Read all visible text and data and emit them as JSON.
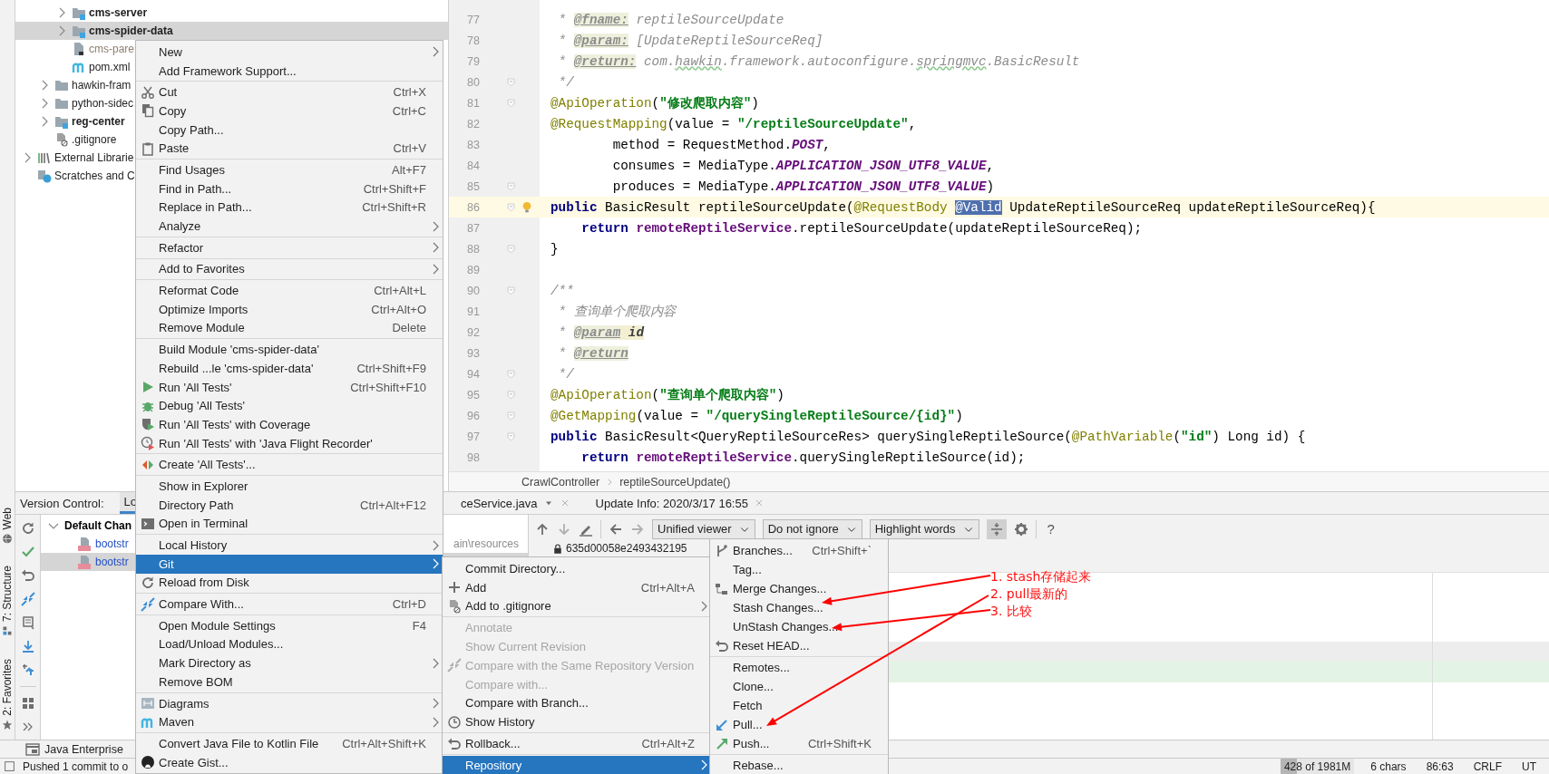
{
  "project_tree": {
    "items": [
      {
        "children": [
          {
            "children": [
              {
                "label": "cms-server",
                "kind": "module",
                "expanded": false,
                "bold": true,
                "ignored": false,
                "selected": false
              },
              {
                "label": "cms-spider-data",
                "kind": "module",
                "expanded": false,
                "bold": true,
                "ignored": false,
                "selected": true
              },
              {
                "label": "cms-pare",
                "kind": "file",
                "bold": false,
                "ignored": true,
                "selected": false
              },
              {
                "label": "pom.xml",
                "kind": "maven",
                "bold": false,
                "ignored": false,
                "selected": false
              }
            ]
          },
          {
            "label": "hawkin-fram",
            "kind": "folder",
            "expanded": false,
            "bold": false,
            "ignored": false,
            "selected": false
          },
          {
            "label": "python-sidec",
            "kind": "folder",
            "expanded": false,
            "bold": false,
            "ignored": false,
            "selected": false
          },
          {
            "label": "reg-center",
            "kind": "module",
            "expanded": false,
            "bold": true,
            "ignored": false,
            "selected": false
          },
          {
            "label": ".gitignore",
            "kind": "ignorefile",
            "bold": false,
            "ignored": false,
            "selected": false
          }
        ]
      },
      {
        "label": "External Librarie",
        "kind": "libraries",
        "expanded": false,
        "bold": false,
        "ignored": false,
        "selected": false
      },
      {
        "label": "Scratches and C",
        "kind": "scratches",
        "bold": false,
        "ignored": false,
        "selected": false
      }
    ]
  },
  "editor": {
    "lines": [
      {
        "number": "77",
        "fold": false,
        "current": false,
        "tokens": [
          {
            "t": " * ",
            "kind": "doc"
          },
          {
            "t": "@fname:",
            "kind": "tag"
          },
          {
            "t": " reptileSourceUpdate",
            "kind": "doc"
          }
        ]
      },
      {
        "number": "78",
        "fold": false,
        "current": false,
        "tokens": [
          {
            "t": " * ",
            "kind": "doc"
          },
          {
            "t": "@param:",
            "kind": "tag"
          },
          {
            "t": " [UpdateReptileSourceReq]",
            "kind": "doc"
          }
        ]
      },
      {
        "number": "79",
        "fold": false,
        "current": false,
        "tokens": [
          {
            "t": " * ",
            "kind": "doc"
          },
          {
            "t": "@return:",
            "kind": "tag"
          },
          {
            "t": " com.",
            "kind": "doc"
          },
          {
            "t": "hawkin",
            "kind": "typo"
          },
          {
            "t": ".framework.autoconfigure.",
            "kind": "doc"
          },
          {
            "t": "springmvc",
            "kind": "typo"
          },
          {
            "t": ".BasicResult",
            "kind": "doc"
          }
        ]
      },
      {
        "number": "80",
        "fold": true,
        "current": false,
        "tokens": [
          {
            "t": " */",
            "kind": "doc"
          }
        ]
      },
      {
        "number": "81",
        "fold": true,
        "current": false,
        "tokens": [
          {
            "t": "@ApiOperation",
            "kind": "ann"
          },
          {
            "t": "(",
            "kind": "plain"
          },
          {
            "t": "\"修改爬取内容\"",
            "kind": "str"
          },
          {
            "t": ")",
            "kind": "plain"
          }
        ]
      },
      {
        "number": "82",
        "fold": false,
        "current": false,
        "tokens": [
          {
            "t": "@RequestMapping",
            "kind": "ann"
          },
          {
            "t": "(value = ",
            "kind": "plain"
          },
          {
            "t": "\"/reptileSourceUpdate\"",
            "kind": "str"
          },
          {
            "t": ",",
            "kind": "plain"
          }
        ]
      },
      {
        "number": "83",
        "fold": false,
        "current": false,
        "tokens": [
          {
            "t": "        method = RequestMethod.",
            "kind": "plain"
          },
          {
            "t": "POST",
            "kind": "const"
          },
          {
            "t": ",",
            "kind": "plain"
          }
        ]
      },
      {
        "number": "84",
        "fold": false,
        "current": false,
        "tokens": [
          {
            "t": "        consumes = MediaType.",
            "kind": "plain"
          },
          {
            "t": "APPLICATION_JSON_UTF8_VALUE",
            "kind": "const"
          },
          {
            "t": ",",
            "kind": "plain"
          }
        ]
      },
      {
        "number": "85",
        "fold": true,
        "current": false,
        "tokens": [
          {
            "t": "        produces = MediaType.",
            "kind": "plain"
          },
          {
            "t": "APPLICATION_JSON_UTF8_VALUE",
            "kind": "const"
          },
          {
            "t": ")",
            "kind": "plain"
          }
        ]
      },
      {
        "number": "86",
        "fold": true,
        "current": true,
        "tokens": [
          {
            "t": "public",
            "kind": "kw"
          },
          {
            "t": " BasicResult reptileSourceUpdate(",
            "kind": "plain"
          },
          {
            "t": "@RequestBody ",
            "kind": "ann"
          },
          {
            "t": "@Valid",
            "kind": "sel"
          },
          {
            "t": " UpdateReptileSourceReq updateReptileSourceReq){",
            "kind": "plain"
          }
        ]
      },
      {
        "number": "87",
        "fold": false,
        "current": false,
        "tokens": [
          {
            "t": "    return ",
            "kind": "kw"
          },
          {
            "t": "remoteReptileService",
            "kind": "field"
          },
          {
            "t": ".reptileSourceUpdate(updateReptileSourceReq);",
            "kind": "plain"
          }
        ]
      },
      {
        "number": "88",
        "fold": true,
        "current": false,
        "tokens": [
          {
            "t": "}",
            "kind": "plain"
          }
        ]
      },
      {
        "number": "89",
        "fold": false,
        "current": false
      },
      {
        "number": "90",
        "fold": true,
        "current": false,
        "tokens": [
          {
            "t": "/**",
            "kind": "doc"
          }
        ]
      },
      {
        "number": "91",
        "fold": false,
        "current": false,
        "tokens": [
          {
            "t": " * 查询单个爬取内容",
            "kind": "doc"
          }
        ]
      },
      {
        "number": "92",
        "fold": false,
        "current": false,
        "tokens": [
          {
            "t": " * ",
            "kind": "doc"
          },
          {
            "t": "@param",
            "kind": "tag"
          },
          {
            "t": " id",
            "kind": "ref"
          }
        ]
      },
      {
        "number": "93",
        "fold": false,
        "current": false,
        "tokens": [
          {
            "t": " * ",
            "kind": "doc"
          },
          {
            "t": "@return",
            "kind": "tag"
          }
        ]
      },
      {
        "number": "94",
        "fold": true,
        "current": false,
        "tokens": [
          {
            "t": " */",
            "kind": "doc"
          }
        ]
      },
      {
        "number": "95",
        "fold": true,
        "current": false,
        "tokens": [
          {
            "t": "@ApiOperation",
            "kind": "ann"
          },
          {
            "t": "(",
            "kind": "plain"
          },
          {
            "t": "\"查询单个爬取内容\"",
            "kind": "str"
          },
          {
            "t": ")",
            "kind": "plain"
          }
        ]
      },
      {
        "number": "96",
        "fold": true,
        "current": false,
        "tokens": [
          {
            "t": "@GetMapping",
            "kind": "ann"
          },
          {
            "t": "(value = ",
            "kind": "plain"
          },
          {
            "t": "\"/querySingleReptileSource/{id}\"",
            "kind": "str"
          },
          {
            "t": ")",
            "kind": "plain"
          }
        ]
      },
      {
        "number": "97",
        "fold": true,
        "current": false,
        "tokens": [
          {
            "t": "public",
            "kind": "kw"
          },
          {
            "t": " BasicResult<QueryReptileSourceRes> querySingleReptileSource(",
            "kind": "plain"
          },
          {
            "t": "@PathVariable",
            "kind": "ann"
          },
          {
            "t": "(",
            "kind": "plain"
          },
          {
            "t": "\"id\"",
            "kind": "str"
          },
          {
            "t": ") Long id) {",
            "kind": "plain"
          }
        ]
      },
      {
        "number": "98",
        "fold": false,
        "current": false,
        "tokens": [
          {
            "t": "    return ",
            "kind": "kw"
          },
          {
            "t": "remoteReptileService",
            "kind": "field"
          },
          {
            "t": ".querySingleReptileSource(id);",
            "kind": "plain"
          }
        ]
      }
    ],
    "breadcrumbs": [
      "CrawlController",
      "reptileSourceUpdate()"
    ]
  },
  "bottom_panel": {
    "title": "Version Control:",
    "tabs": [
      {
        "label": "Lo",
        "selected": true,
        "dropdown": false,
        "closable": false
      },
      {
        "label": "ceService.java",
        "selected": false,
        "dropdown": true,
        "closable": true
      },
      {
        "label": "Update Info: 2020/3/17 16:55",
        "selected": false,
        "dropdown": false,
        "closable": true
      }
    ],
    "changes": {
      "label": "Default Chan",
      "expanded": true,
      "children": [
        {
          "label": "bootstr",
          "path": "ain\\resources",
          "modified": true,
          "selected": false
        },
        {
          "label": "bootstr",
          "modified": true,
          "selected": true
        }
      ]
    },
    "diff": {
      "dropdowns": [
        "Unified viewer",
        "Do not ignore",
        "Highlight words"
      ],
      "collapse_on": true,
      "help": "?",
      "revision": "635d00058e2493432195"
    }
  },
  "stripe": [
    "Web",
    "7: Structure",
    "2: Favorites"
  ],
  "tool_tabs": [
    {
      "label": "Java Enterprise"
    }
  ],
  "status_bar": {
    "message": "Pushed 1 commit to o",
    "memory": {
      "text": "428 of 1981M",
      "level": 0.22
    },
    "items": [
      "6 chars",
      "86:63",
      "CRLF",
      "UT"
    ]
  },
  "context_menu": {
    "groups": [
      [
        {
          "label": "New",
          "submenu": true,
          "selected": false
        },
        {
          "label": "Add Framework Support...",
          "submenu": false,
          "selected": false
        }
      ],
      [
        {
          "label": "Cut",
          "shortcut": "Ctrl+X",
          "submenu": false,
          "selected": false
        },
        {
          "label": "Copy",
          "shortcut": "Ctrl+C",
          "submenu": false,
          "selected": false
        },
        {
          "label": "Copy Path...",
          "submenu": false,
          "selected": false
        },
        {
          "label": "Paste",
          "shortcut": "Ctrl+V",
          "submenu": false,
          "selected": false
        }
      ],
      [
        {
          "label": "Find Usages",
          "shortcut": "Alt+F7",
          "submenu": false,
          "selected": false
        },
        {
          "label": "Find in Path...",
          "shortcut": "Ctrl+Shift+F",
          "submenu": false,
          "selected": false
        },
        {
          "label": "Replace in Path...",
          "shortcut": "Ctrl+Shift+R",
          "submenu": false,
          "selected": false
        },
        {
          "label": "Analyze",
          "submenu": true,
          "selected": false
        }
      ],
      [
        {
          "label": "Refactor",
          "submenu": true,
          "selected": false
        }
      ],
      [
        {
          "label": "Add to Favorites",
          "submenu": true,
          "selected": false
        }
      ],
      [
        {
          "label": "Reformat Code",
          "shortcut": "Ctrl+Alt+L",
          "submenu": false,
          "selected": false
        },
        {
          "label": "Optimize Imports",
          "shortcut": "Ctrl+Alt+O",
          "submenu": false,
          "selected": false
        },
        {
          "label": "Remove Module",
          "shortcut": "Delete",
          "submenu": false,
          "selected": false
        }
      ],
      [
        {
          "label": "Build Module 'cms-spider-data'",
          "submenu": false,
          "selected": false
        },
        {
          "label": "Rebuild ...le 'cms-spider-data'",
          "shortcut": "Ctrl+Shift+F9",
          "submenu": false,
          "selected": false
        },
        {
          "label": "Run 'All Tests'",
          "shortcut": "Ctrl+Shift+F10",
          "submenu": false,
          "selected": false
        },
        {
          "label": "Debug 'All Tests'",
          "submenu": false,
          "selected": false
        },
        {
          "label": "Run 'All Tests' with Coverage",
          "submenu": false,
          "selected": false
        },
        {
          "label": "Run 'All Tests' with 'Java Flight Recorder'",
          "submenu": false,
          "selected": false
        }
      ],
      [
        {
          "label": "Create 'All Tests'...",
          "submenu": false,
          "selected": false
        }
      ],
      [
        {
          "label": "Show in Explorer",
          "submenu": false,
          "selected": false
        },
        {
          "label": "Directory Path",
          "shortcut": "Ctrl+Alt+F12",
          "submenu": false,
          "selected": false
        },
        {
          "label": "Open in Terminal",
          "submenu": false,
          "selected": false
        }
      ],
      [
        {
          "label": "Local History",
          "submenu": true,
          "selected": false
        },
        {
          "label": "Git",
          "submenu": true,
          "selected": true
        },
        {
          "label": "Reload from Disk",
          "submenu": false,
          "selected": false
        }
      ],
      [
        {
          "label": "Compare With...",
          "shortcut": "Ctrl+D",
          "submenu": false,
          "selected": false
        }
      ],
      [
        {
          "label": "Open Module Settings",
          "shortcut": "F4",
          "submenu": false,
          "selected": false
        },
        {
          "label": "Load/Unload Modules...",
          "submenu": false,
          "selected": false
        },
        {
          "label": "Mark Directory as",
          "submenu": true,
          "selected": false
        },
        {
          "label": "Remove BOM",
          "submenu": false,
          "selected": false
        }
      ],
      [
        {
          "label": "Diagrams",
          "submenu": true,
          "selected": false
        },
        {
          "label": "Maven",
          "submenu": true,
          "selected": false
        }
      ],
      [
        {
          "label": "Convert Java File to Kotlin File",
          "shortcut": "Ctrl+Alt+Shift+K",
          "submenu": false,
          "selected": false
        },
        {
          "label": "Create Gist...",
          "submenu": false,
          "selected": false
        }
      ]
    ]
  },
  "git_submenu": {
    "groups": [
      [
        {
          "label": "Commit Directory...",
          "submenu": false,
          "selected": false,
          "disabled": false
        },
        {
          "label": "Add",
          "shortcut": "Ctrl+Alt+A",
          "submenu": false,
          "selected": false,
          "disabled": false
        },
        {
          "label": "Add to .gitignore",
          "submenu": true,
          "selected": false,
          "disabled": false
        }
      ],
      [
        {
          "label": "Annotate",
          "submenu": false,
          "selected": false,
          "disabled": true
        },
        {
          "label": "Show Current Revision",
          "submenu": false,
          "selected": false,
          "disabled": true
        },
        {
          "label": "Compare with the Same Repository Version",
          "submenu": false,
          "selected": false,
          "disabled": true
        },
        {
          "label": "Compare with...",
          "submenu": false,
          "selected": false,
          "disabled": true
        },
        {
          "label": "Compare with Branch...",
          "submenu": false,
          "selected": false,
          "disabled": false
        },
        {
          "label": "Show History",
          "submenu": false,
          "selected": false,
          "disabled": false
        }
      ],
      [
        {
          "label": "Rollback...",
          "shortcut": "Ctrl+Alt+Z",
          "submenu": false,
          "selected": false,
          "disabled": false
        }
      ],
      [
        {
          "label": "Repository",
          "submenu": true,
          "selected": true,
          "disabled": false
        }
      ]
    ]
  },
  "repository_submenu": {
    "groups": [
      [
        {
          "label": "Branches...",
          "shortcut": "Ctrl+Shift+`",
          "submenu": false,
          "selected": false
        },
        {
          "label": "Tag...",
          "submenu": false,
          "selected": false
        },
        {
          "label": "Merge Changes...",
          "submenu": false,
          "selected": false
        },
        {
          "label": "Stash Changes...",
          "submenu": false,
          "selected": false
        },
        {
          "label": "UnStash Changes...",
          "submenu": false,
          "selected": false
        },
        {
          "label": "Reset HEAD...",
          "submenu": false,
          "selected": false
        }
      ],
      [
        {
          "label": "Remotes...",
          "submenu": false,
          "selected": false
        },
        {
          "label": "Clone...",
          "submenu": false,
          "selected": false
        },
        {
          "label": "Fetch",
          "submenu": false,
          "selected": false
        },
        {
          "label": "Pull...",
          "submenu": false,
          "selected": false
        },
        {
          "label": "Push...",
          "shortcut": "Ctrl+Shift+K",
          "submenu": false,
          "selected": false
        }
      ],
      [
        {
          "label": "Rebase...",
          "submenu": false,
          "selected": false
        }
      ]
    ]
  },
  "annotations": [
    {
      "text": "1. stash存储起来"
    },
    {
      "text": "2. pull最新的"
    },
    {
      "text": "3. 比较"
    }
  ]
}
